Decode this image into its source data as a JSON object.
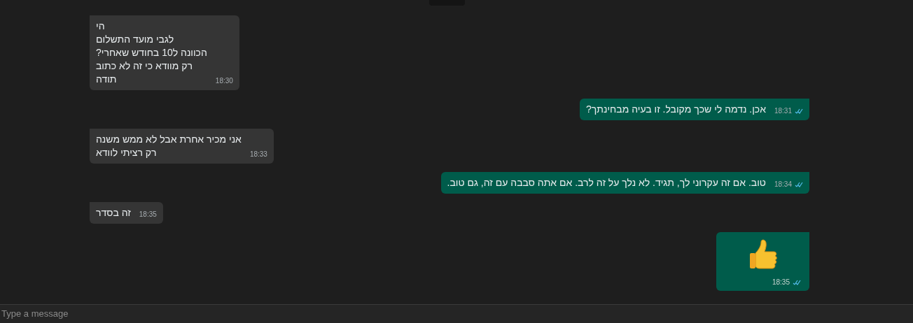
{
  "messages": [
    {
      "outgoing": false,
      "kind": "text",
      "text": "הי\nלגבי מועד התשלום\nהכוונה ל10 בחודש שאחרי?\nרק מוודא כי זה לא כתוב\nתודה",
      "time": "18:30"
    },
    {
      "outgoing": true,
      "kind": "text",
      "text": "אכן. נדמה לי שכך מקובל. זו בעיה מבחינתך?",
      "time": "18:31",
      "read": true
    },
    {
      "outgoing": false,
      "kind": "text",
      "text": "אני מכיר אחרת אבל לא ממש משנה\nרק רציתי לוודא",
      "time": "18:33"
    },
    {
      "outgoing": true,
      "kind": "text",
      "text": "טוב.  אם זה עקרוני לך, תגיד.  לא נלך על זה לרב. אם אתה סבבה עם זה, גם טוב.",
      "time": "18:34",
      "read": true
    },
    {
      "outgoing": false,
      "kind": "text",
      "text": "זה בסדר",
      "time": "18:35"
    },
    {
      "outgoing": true,
      "kind": "emoji",
      "time": "18:35",
      "read": true
    }
  ],
  "composer": {
    "placeholder": "Type a message"
  }
}
